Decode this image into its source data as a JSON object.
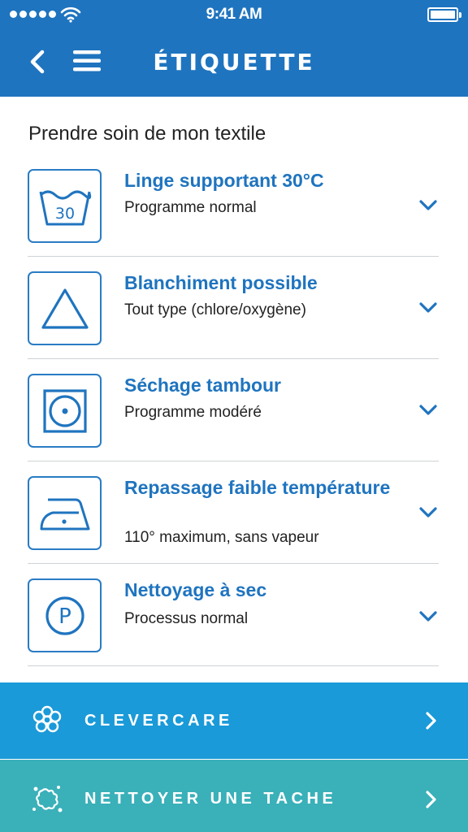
{
  "status_bar": {
    "time": "9:41 AM"
  },
  "header": {
    "title": "ÉTIQUETTE"
  },
  "section": {
    "title": "Prendre soin de mon textile"
  },
  "care_items": [
    {
      "icon": "wash-30-icon",
      "symbol_text": "30",
      "label": "Linge supportant 30°C",
      "description": "Programme normal"
    },
    {
      "icon": "bleach-triangle-icon",
      "label": "Blanchiment possible",
      "description": "Tout type (chlore/oxygène)"
    },
    {
      "icon": "tumble-dry-icon",
      "label": "Séchage tambour",
      "description": "Programme modéré"
    },
    {
      "icon": "iron-low-icon",
      "label": "Repassage faible température",
      "description": "110° maximum, sans vapeur"
    },
    {
      "icon": "dry-clean-p-icon",
      "symbol_text": "P",
      "label": "Nettoyage à sec",
      "description": "Processus normal"
    }
  ],
  "banners": [
    {
      "icon": "flower-icon",
      "label": "CLEVERCARE"
    },
    {
      "icon": "stain-splash-icon",
      "label": "NETTOYER UNE TACHE"
    }
  ],
  "colors": {
    "header": "#1f74bf",
    "accent_text": "#1f74bf",
    "banner_1": "#1a9ad8",
    "banner_2": "#3ab0b9"
  }
}
